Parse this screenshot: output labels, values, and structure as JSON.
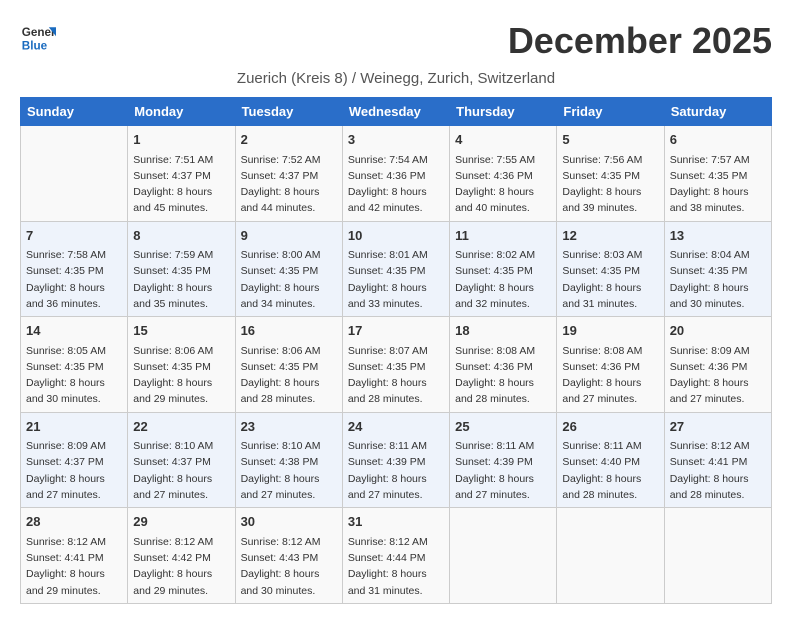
{
  "header": {
    "logo_general": "General",
    "logo_blue": "Blue",
    "month_title": "December 2025",
    "subtitle": "Zuerich (Kreis 8) / Weinegg, Zurich, Switzerland"
  },
  "weekdays": [
    "Sunday",
    "Monday",
    "Tuesday",
    "Wednesday",
    "Thursday",
    "Friday",
    "Saturday"
  ],
  "weeks": [
    [
      {
        "day": "",
        "sunrise": "",
        "sunset": "",
        "daylight": ""
      },
      {
        "day": "1",
        "sunrise": "Sunrise: 7:51 AM",
        "sunset": "Sunset: 4:37 PM",
        "daylight": "Daylight: 8 hours and 45 minutes."
      },
      {
        "day": "2",
        "sunrise": "Sunrise: 7:52 AM",
        "sunset": "Sunset: 4:37 PM",
        "daylight": "Daylight: 8 hours and 44 minutes."
      },
      {
        "day": "3",
        "sunrise": "Sunrise: 7:54 AM",
        "sunset": "Sunset: 4:36 PM",
        "daylight": "Daylight: 8 hours and 42 minutes."
      },
      {
        "day": "4",
        "sunrise": "Sunrise: 7:55 AM",
        "sunset": "Sunset: 4:36 PM",
        "daylight": "Daylight: 8 hours and 40 minutes."
      },
      {
        "day": "5",
        "sunrise": "Sunrise: 7:56 AM",
        "sunset": "Sunset: 4:35 PM",
        "daylight": "Daylight: 8 hours and 39 minutes."
      },
      {
        "day": "6",
        "sunrise": "Sunrise: 7:57 AM",
        "sunset": "Sunset: 4:35 PM",
        "daylight": "Daylight: 8 hours and 38 minutes."
      }
    ],
    [
      {
        "day": "7",
        "sunrise": "Sunrise: 7:58 AM",
        "sunset": "Sunset: 4:35 PM",
        "daylight": "Daylight: 8 hours and 36 minutes."
      },
      {
        "day": "8",
        "sunrise": "Sunrise: 7:59 AM",
        "sunset": "Sunset: 4:35 PM",
        "daylight": "Daylight: 8 hours and 35 minutes."
      },
      {
        "day": "9",
        "sunrise": "Sunrise: 8:00 AM",
        "sunset": "Sunset: 4:35 PM",
        "daylight": "Daylight: 8 hours and 34 minutes."
      },
      {
        "day": "10",
        "sunrise": "Sunrise: 8:01 AM",
        "sunset": "Sunset: 4:35 PM",
        "daylight": "Daylight: 8 hours and 33 minutes."
      },
      {
        "day": "11",
        "sunrise": "Sunrise: 8:02 AM",
        "sunset": "Sunset: 4:35 PM",
        "daylight": "Daylight: 8 hours and 32 minutes."
      },
      {
        "day": "12",
        "sunrise": "Sunrise: 8:03 AM",
        "sunset": "Sunset: 4:35 PM",
        "daylight": "Daylight: 8 hours and 31 minutes."
      },
      {
        "day": "13",
        "sunrise": "Sunrise: 8:04 AM",
        "sunset": "Sunset: 4:35 PM",
        "daylight": "Daylight: 8 hours and 30 minutes."
      }
    ],
    [
      {
        "day": "14",
        "sunrise": "Sunrise: 8:05 AM",
        "sunset": "Sunset: 4:35 PM",
        "daylight": "Daylight: 8 hours and 30 minutes."
      },
      {
        "day": "15",
        "sunrise": "Sunrise: 8:06 AM",
        "sunset": "Sunset: 4:35 PM",
        "daylight": "Daylight: 8 hours and 29 minutes."
      },
      {
        "day": "16",
        "sunrise": "Sunrise: 8:06 AM",
        "sunset": "Sunset: 4:35 PM",
        "daylight": "Daylight: 8 hours and 28 minutes."
      },
      {
        "day": "17",
        "sunrise": "Sunrise: 8:07 AM",
        "sunset": "Sunset: 4:35 PM",
        "daylight": "Daylight: 8 hours and 28 minutes."
      },
      {
        "day": "18",
        "sunrise": "Sunrise: 8:08 AM",
        "sunset": "Sunset: 4:36 PM",
        "daylight": "Daylight: 8 hours and 28 minutes."
      },
      {
        "day": "19",
        "sunrise": "Sunrise: 8:08 AM",
        "sunset": "Sunset: 4:36 PM",
        "daylight": "Daylight: 8 hours and 27 minutes."
      },
      {
        "day": "20",
        "sunrise": "Sunrise: 8:09 AM",
        "sunset": "Sunset: 4:36 PM",
        "daylight": "Daylight: 8 hours and 27 minutes."
      }
    ],
    [
      {
        "day": "21",
        "sunrise": "Sunrise: 8:09 AM",
        "sunset": "Sunset: 4:37 PM",
        "daylight": "Daylight: 8 hours and 27 minutes."
      },
      {
        "day": "22",
        "sunrise": "Sunrise: 8:10 AM",
        "sunset": "Sunset: 4:37 PM",
        "daylight": "Daylight: 8 hours and 27 minutes."
      },
      {
        "day": "23",
        "sunrise": "Sunrise: 8:10 AM",
        "sunset": "Sunset: 4:38 PM",
        "daylight": "Daylight: 8 hours and 27 minutes."
      },
      {
        "day": "24",
        "sunrise": "Sunrise: 8:11 AM",
        "sunset": "Sunset: 4:39 PM",
        "daylight": "Daylight: 8 hours and 27 minutes."
      },
      {
        "day": "25",
        "sunrise": "Sunrise: 8:11 AM",
        "sunset": "Sunset: 4:39 PM",
        "daylight": "Daylight: 8 hours and 27 minutes."
      },
      {
        "day": "26",
        "sunrise": "Sunrise: 8:11 AM",
        "sunset": "Sunset: 4:40 PM",
        "daylight": "Daylight: 8 hours and 28 minutes."
      },
      {
        "day": "27",
        "sunrise": "Sunrise: 8:12 AM",
        "sunset": "Sunset: 4:41 PM",
        "daylight": "Daylight: 8 hours and 28 minutes."
      }
    ],
    [
      {
        "day": "28",
        "sunrise": "Sunrise: 8:12 AM",
        "sunset": "Sunset: 4:41 PM",
        "daylight": "Daylight: 8 hours and 29 minutes."
      },
      {
        "day": "29",
        "sunrise": "Sunrise: 8:12 AM",
        "sunset": "Sunset: 4:42 PM",
        "daylight": "Daylight: 8 hours and 29 minutes."
      },
      {
        "day": "30",
        "sunrise": "Sunrise: 8:12 AM",
        "sunset": "Sunset: 4:43 PM",
        "daylight": "Daylight: 8 hours and 30 minutes."
      },
      {
        "day": "31",
        "sunrise": "Sunrise: 8:12 AM",
        "sunset": "Sunset: 4:44 PM",
        "daylight": "Daylight: 8 hours and 31 minutes."
      },
      {
        "day": "",
        "sunrise": "",
        "sunset": "",
        "daylight": ""
      },
      {
        "day": "",
        "sunrise": "",
        "sunset": "",
        "daylight": ""
      },
      {
        "day": "",
        "sunrise": "",
        "sunset": "",
        "daylight": ""
      }
    ]
  ]
}
